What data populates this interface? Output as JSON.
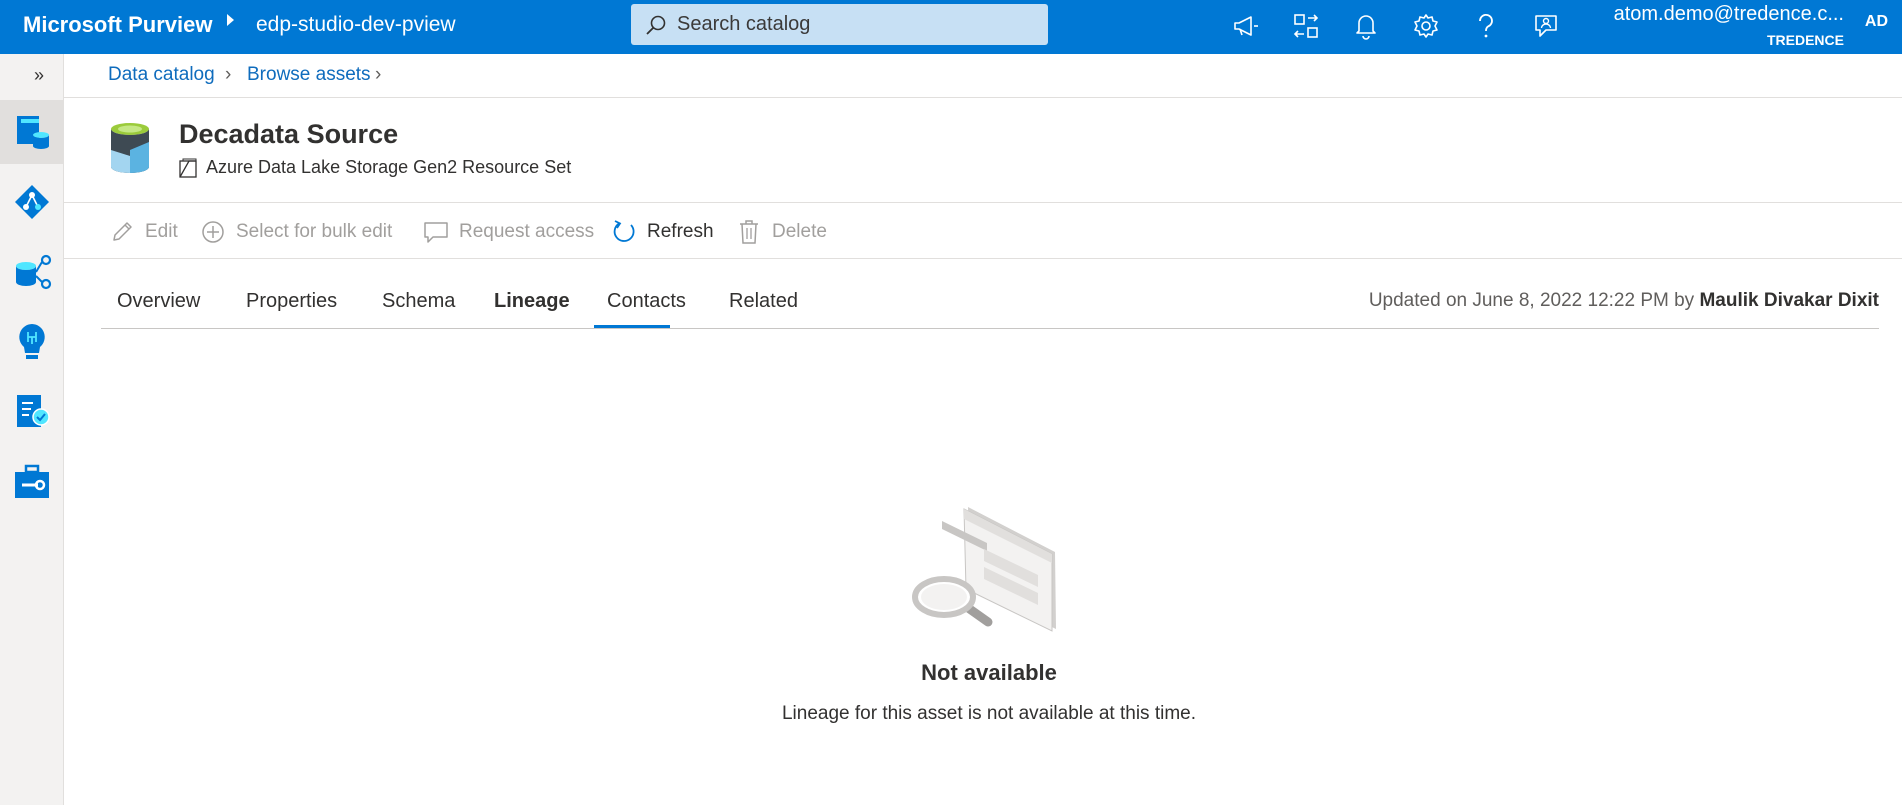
{
  "topbar": {
    "brand": "Microsoft Purview",
    "account": "edp-studio-dev-pview",
    "search_placeholder": "Search catalog",
    "user_email": "atom.demo@tredence.c...",
    "user_org": "TREDENCE",
    "user_initials": "AD",
    "icons": [
      "announcement-icon",
      "switch-directory-icon",
      "notifications-icon",
      "settings-icon",
      "help-icon",
      "feedback-icon"
    ]
  },
  "leftrail": {
    "expand_glyph": "»",
    "items": [
      "data-catalog-icon",
      "data-map-icon",
      "data-estate-insights-icon",
      "data-policy-icon",
      "data-sharing-icon",
      "management-icon"
    ]
  },
  "breadcrumb": {
    "items": [
      "Data catalog",
      "Browse assets"
    ]
  },
  "asset": {
    "title": "Decadata Source",
    "type": "Azure Data Lake Storage Gen2 Resource Set"
  },
  "commands": {
    "edit": "Edit",
    "bulk_edit": "Select for bulk edit",
    "request_access": "Request access",
    "refresh": "Refresh",
    "delete": "Delete"
  },
  "tabs": {
    "items": [
      "Overview",
      "Properties",
      "Schema",
      "Lineage",
      "Contacts",
      "Related"
    ],
    "active": "Lineage",
    "updated_prefix": "Updated on June 8, 2022 12:22 PM by",
    "updated_by": "Maulik Divakar Dixit"
  },
  "empty_state": {
    "title": "Not available",
    "description": "Lineage for this asset is not available at this time."
  },
  "colors": {
    "accent": "#0078d4",
    "link": "#0f6cbd"
  }
}
